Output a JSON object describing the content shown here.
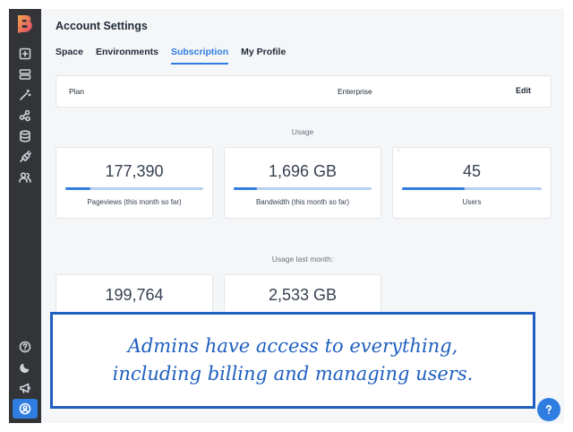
{
  "header": {
    "title": "Account Settings"
  },
  "tabs": [
    {
      "label": "Space"
    },
    {
      "label": "Environments"
    },
    {
      "label": "Subscription",
      "active": true
    },
    {
      "label": "My Profile"
    }
  ],
  "plan": {
    "label": "Plan",
    "value": "Enterprise",
    "edit_label": "Edit"
  },
  "usage": {
    "heading": "Usage",
    "cards": [
      {
        "value": "177,390",
        "caption": "Pageviews (this month so far)",
        "progress": 0.18
      },
      {
        "value": "1,696 GB",
        "caption": "Bandwidth (this month so far)",
        "progress": 0.17
      },
      {
        "value": "45",
        "caption": "Users",
        "progress": 0.45,
        "corner": "¹"
      }
    ]
  },
  "usage_last_month": {
    "heading": "Usage last month:",
    "cards": [
      {
        "value": "199,764"
      },
      {
        "value": "2,533 GB"
      }
    ]
  },
  "callout": {
    "line1": "Admins have access to everything,",
    "line2": "including billing and managing users."
  },
  "colors": {
    "accent": "#2f7de1",
    "sidebar": "#333438",
    "callout": "#1f5fbf"
  },
  "sidebar": {
    "icons": [
      "logo-icon",
      "add-content-icon",
      "layers-icon",
      "magic-wand-icon",
      "nodes-icon",
      "database-icon",
      "plug-icon",
      "users-icon",
      "help-icon",
      "moon-icon",
      "megaphone-icon",
      "account-icon"
    ]
  }
}
